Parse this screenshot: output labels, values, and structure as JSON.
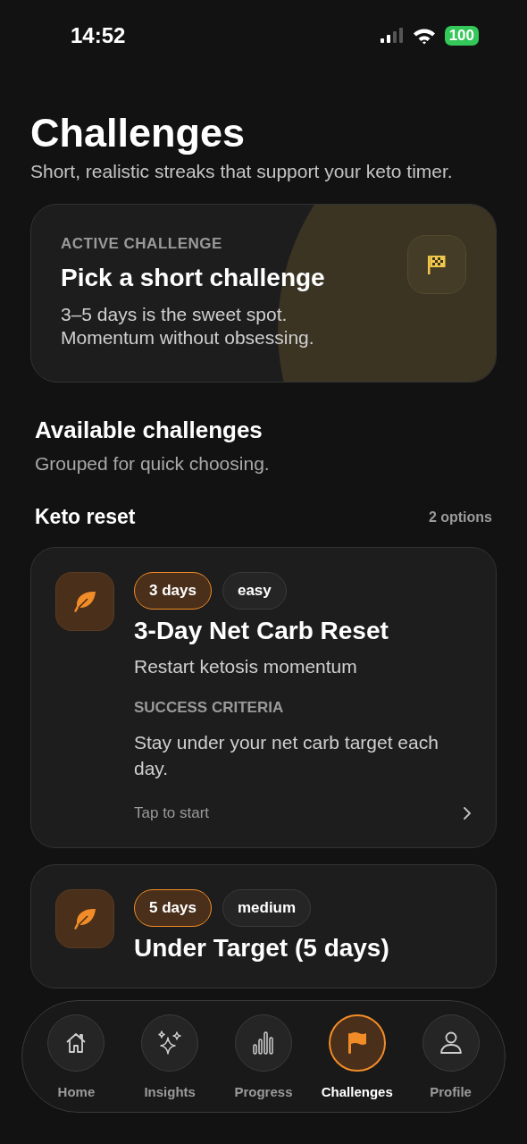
{
  "status_bar": {
    "time": "14:52",
    "battery": "100"
  },
  "header": {
    "title": "Challenges",
    "subtitle": "Short, realistic streaks that support your keto timer."
  },
  "active_card": {
    "eyebrow": "ACTIVE CHALLENGE",
    "title": "Pick a short challenge",
    "lines": [
      "3–5 days is the sweet spot.",
      "Momentum without obsessing."
    ]
  },
  "section": {
    "title": "Available challenges",
    "subtitle": "Grouped for quick choosing."
  },
  "group": {
    "title": "Keto reset",
    "count": "2 options"
  },
  "challenges": [
    {
      "tags": [
        {
          "kind": "duration",
          "label": "3 days"
        },
        {
          "kind": "difficulty",
          "label": "easy"
        }
      ],
      "title": "3-Day Net Carb Reset",
      "subtitle": "Restart ketosis momentum",
      "criteria_label": "SUCCESS CRITERIA",
      "criteria": "Stay under your net carb target each day.",
      "action": "Tap to start"
    },
    {
      "tags": [
        {
          "kind": "duration",
          "label": "5 days"
        },
        {
          "kind": "difficulty",
          "label": "medium"
        }
      ],
      "title": "Under Target (5 days)"
    }
  ],
  "tab_bar": [
    {
      "kind": "home",
      "label": "Home",
      "selected": false
    },
    {
      "kind": "insights",
      "label": "Insights",
      "selected": false
    },
    {
      "kind": "progress",
      "label": "Progress",
      "selected": false
    },
    {
      "kind": "challenges",
      "label": "Challenges",
      "selected": true
    },
    {
      "kind": "profile",
      "label": "Profile",
      "selected": false
    }
  ]
}
